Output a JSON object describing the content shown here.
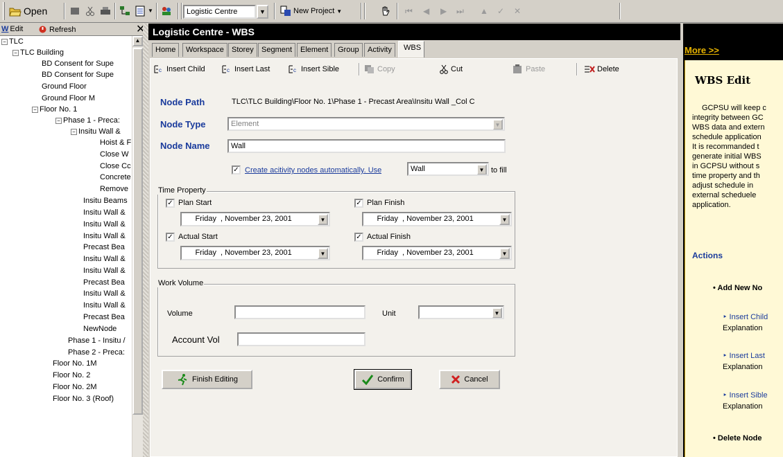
{
  "toolbar": {
    "open_label": "Open",
    "project_combo": "Logistic Centre",
    "new_project_label": "New Project"
  },
  "left_panel": {
    "edit_label": "Edit",
    "refresh_label": "Refresh",
    "tree": [
      "TLC",
      "TLC Building",
      "BD Consent for Supe",
      "BD Consent for Supe",
      "Ground Floor",
      "Ground Floor M",
      "Floor No. 1",
      "Phase 1 - Preca:",
      "Insitu Wall &",
      "Hoist & F",
      "Close W",
      "Close Cc",
      "Concrete",
      "Remove",
      "Insitu Beams",
      "Insitu Wall &",
      "Insitu Wall &",
      "Insitu Wall &",
      "Precast Bea",
      "Insitu Wall &",
      "Insitu Wall &",
      "Precast Bea",
      "Insitu Wall &",
      "Insitu Wall &",
      "Precast Bea",
      "NewNode",
      "Phase 1 - Insitu /",
      "Phase 2 - Preca:",
      "Floor No. 1M",
      "Floor No. 2",
      "Floor No. 2M",
      "Floor No. 3 (Roof)"
    ]
  },
  "window": {
    "title": "Logistic Centre - WBS",
    "tabs": [
      "Home",
      "Workspace",
      "Storey",
      "Segment",
      "Element",
      "Group",
      "Activity",
      "WBS"
    ]
  },
  "actions": {
    "insert_child": "Insert Child",
    "insert_last": "Insert Last",
    "insert_sible": "Insert Sible",
    "copy": "Copy",
    "cut": "Cut",
    "paste": "Paste",
    "delete": "Delete"
  },
  "form": {
    "node_path_label": "Node Path",
    "node_path_value": "TLC\\TLC Building\\Floor No. 1\\Phase 1 - Precast Area\\Insitu Wall _Col C",
    "node_type_label": "Node Type",
    "node_type_value": "Element",
    "node_name_label": "Node Name",
    "node_name_value": "Wall",
    "auto_create_label": "Create acitivity nodes automatically. Use",
    "auto_create_value": "Wall",
    "to_fill": "to fill",
    "time_property_title": "Time Property",
    "plan_start_label": "Plan Start",
    "plan_finish_label": "Plan Finish",
    "actual_start_label": "Actual Start",
    "actual_finish_label": "Actual Finish",
    "plan_start_day": "Friday",
    "plan_start_date": ", November 23, 2001",
    "plan_finish_day": "Friday",
    "plan_finish_date": ", November 23, 2001",
    "actual_start_day": "Friday",
    "actual_start_date": ", November 23, 2001",
    "actual_finish_day": "Friday",
    "actual_finish_date": ", November 23, 2001",
    "work_volume_title": "Work Volume",
    "volume_label": "Volume",
    "unit_label": "Unit",
    "account_vol_label": "Account Vol"
  },
  "buttons": {
    "finish_editing": "Finish Editing",
    "confirm": "Confirm",
    "cancel": "Cancel"
  },
  "help": {
    "more": "More >>",
    "title": "WBS Edit",
    "body": [
      "GCPSU will keep c",
      "integrity between GC",
      "WBS data and extern",
      "schedule application",
      "It is recommanded t",
      "generate initial WBS",
      "in GCPSU without s",
      "time property and th",
      "adjust schedule in",
      "external scheduele",
      "application."
    ],
    "actions_heading": "Actions",
    "add_new_node": "Add New No",
    "insert_child": "Insert Child",
    "insert_last": "Insert Last",
    "insert_sible": "Insert Sible",
    "explanation": "Explanation",
    "delete_node": "Delete Node"
  }
}
